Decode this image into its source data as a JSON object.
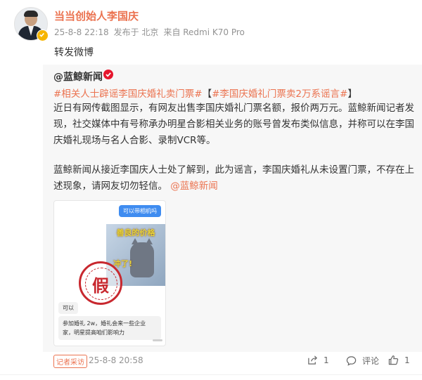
{
  "post": {
    "author": "当当创始人李国庆",
    "time": "25-8-8 22:18",
    "location": "发布于 北京",
    "device": "来自 Redmi K70 Pro",
    "text": "转发微博"
  },
  "original": {
    "author": "@蓝鲸新闻",
    "topic1": "#相关人士辟谣李国庆婚礼卖门票#",
    "topic2": "#李国庆婚礼门票卖2万系谣言#",
    "paragraph1": "近日有网传截图显示，有网友出售李国庆婚礼门票名额，报价两万元。蓝鲸新闻记者发现，社交媒体中有号称承办明星合影相关业务的账号曾发布类似信息，并称可以在李国庆婚礼现场与名人合影、录制VCR等。",
    "paragraph2": "蓝鲸新闻从接近李国庆人士处了解到，此为谣言，李国庆婚礼从未设置门票，不存在上述现象，请网友切勿轻信。",
    "mention": "@蓝鲸新闻",
    "image": {
      "bubble_right": "可以带相机吗",
      "meme_top": "善良的价格",
      "meme_bottom": "冲了!",
      "stamp": "假",
      "bubble_left1": "可以",
      "bubble_left2": "参加婚礼 2w，婚礼会来一些企业家，明星提高咱们影响力"
    },
    "tag": "记者采访",
    "time": "25-8-8 20:58",
    "actions": {
      "share": "1",
      "comment": "评论",
      "like": "1"
    }
  },
  "colors": {
    "accent": "#eb7350",
    "meta": "#939393",
    "verified_badge": "#f6b500",
    "org_badge": "#e6162d",
    "stamp": "#c8282f"
  }
}
